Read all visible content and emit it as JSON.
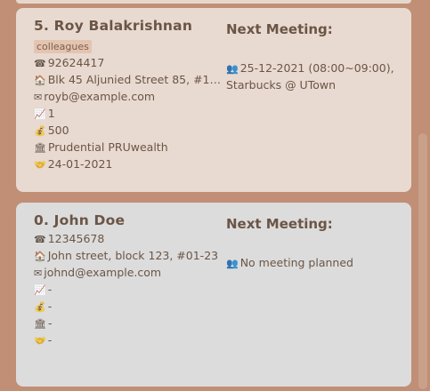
{
  "persons": [
    {
      "index_name": "5.  Roy Balakrishnan",
      "tag": "colleagues",
      "phone": "92624417",
      "address": "Blk 45 Aljunied Street 85, #11...",
      "email": "royb@example.com",
      "stat1": "1",
      "stat2": "500",
      "insurance": "Prudential PRUwealth",
      "date": "24-01-2021",
      "next_meeting_title": "Next Meeting:",
      "next_meeting": "25-12-2021 (08:00~09:00), Starbucks @ UTown"
    },
    {
      "index_name": "0.  John Doe",
      "phone": "12345678",
      "address": "John street, block 123, #01-23",
      "email": "johnd@example.com",
      "stat1": "-",
      "stat2": "-",
      "insurance": "-",
      "date": "-",
      "next_meeting_title": "Next Meeting:",
      "next_meeting": "No meeting planned"
    }
  ],
  "icons": {
    "phone": "phone-icon",
    "address": "house-icon",
    "email": "mail-icon",
    "stat1": "chart-icon",
    "stat2": "money-bag-icon",
    "insurance": "bank-icon",
    "date": "handshake-icon",
    "meeting": "meeting-icon"
  },
  "colors": {
    "background": "#c08f76",
    "selected_card": "#e8dad0",
    "card": "#dcdcdc",
    "tag_bg": "#e4c4b0",
    "text": "#6b5546"
  }
}
